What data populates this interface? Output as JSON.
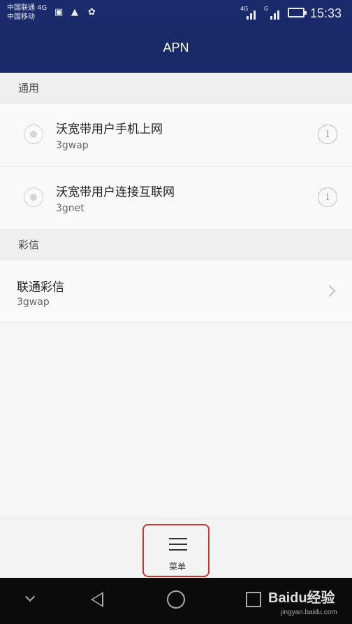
{
  "status_bar": {
    "carrier1": "中国联通 4G",
    "carrier2": "中国移动",
    "signal1_tag": "4G",
    "signal2_tag": "G",
    "time": "15:33",
    "icons": [
      "gallery-icon",
      "warning-icon",
      "huawei-icon",
      "signal-icon",
      "battery-icon"
    ]
  },
  "header": {
    "title": "APN"
  },
  "sections": [
    {
      "header": "通用",
      "items": [
        {
          "title": "沃宽带用户手机上网",
          "subtitle": "3gwap"
        },
        {
          "title": "沃宽带用户连接互联网",
          "subtitle": "3gnet"
        }
      ]
    },
    {
      "header": "彩信",
      "items": [
        {
          "title": "联通彩信",
          "subtitle": "3gwap"
        }
      ]
    }
  ],
  "bottom_menu": {
    "label": "菜单"
  },
  "watermark": {
    "main": "Baidu经验",
    "sub": "jingyan.baidu.com"
  },
  "colors": {
    "header_bg": "#1a2a6a",
    "highlight": "#cc3333"
  }
}
